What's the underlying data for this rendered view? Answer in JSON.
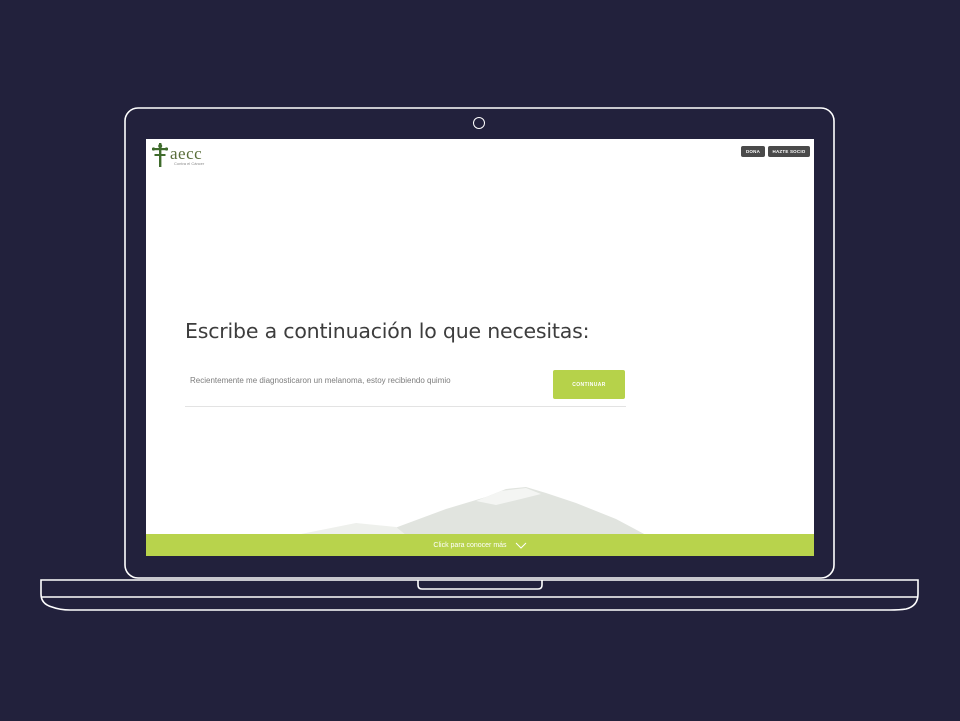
{
  "logo": {
    "name": "aecc",
    "tagline": "Contra el Cáncer"
  },
  "header": {
    "donate_label": "DONA",
    "join_label": "HAZTE SOCIO"
  },
  "main": {
    "heading": "Escribe a continuación lo que necesitas:",
    "query_value": "Recientemente me diagnosticaron un melanoma, estoy recibiendo quimio",
    "continue_label": "CONTINUAR"
  },
  "footer": {
    "more_label": "Click para conocer más"
  },
  "colors": {
    "background": "#22213c",
    "accent_green": "#b6d24a",
    "logo_green": "#5a6e3a",
    "button_dark": "#4a4a4a"
  }
}
